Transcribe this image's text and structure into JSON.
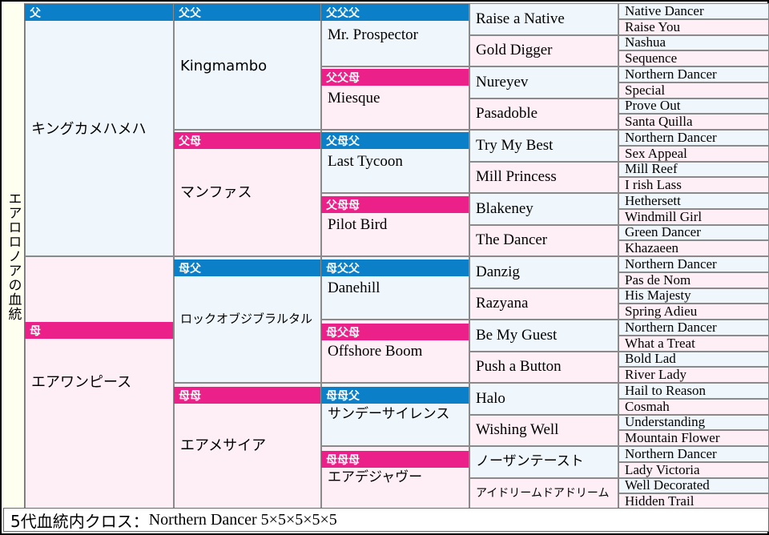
{
  "title_vertical": "エアロロノアの血統",
  "labels": {
    "sire": "父",
    "dam": "母",
    "sire_sire": "父父",
    "sire_dam": "父母",
    "dam_sire": "母父",
    "dam_dam": "母母",
    "sire_sire_sire": "父父父",
    "sire_sire_dam": "父父母",
    "sire_dam_sire": "父母父",
    "sire_dam_dam": "父母母",
    "dam_sire_sire": "母父父",
    "dam_sire_dam": "母父母",
    "dam_dam_sire": "母母父",
    "dam_dam_dam": "母母母"
  },
  "colors": {
    "sire_band": "#0b80c8",
    "dam_band": "#ec2089",
    "sire_cell": "#eff7fc",
    "dam_cell": "#fdeff5",
    "border": "#8a8a8a",
    "title_bg": "#fffff0"
  },
  "gen1": [
    {
      "name": "キングカメハメハ",
      "type": "sire"
    },
    {
      "name": "エアワンピース",
      "type": "dam"
    }
  ],
  "gen2": [
    {
      "name": "Kingmambo",
      "type": "sire"
    },
    {
      "name": "マンファス",
      "type": "dam"
    },
    {
      "name": "ロックオブジブラルタル",
      "type": "sire"
    },
    {
      "name": "エアメサイア",
      "type": "dam"
    }
  ],
  "gen3": [
    {
      "name": "Mr.  Prospector",
      "type": "sire"
    },
    {
      "name": "Miesque",
      "type": "dam"
    },
    {
      "name": "Last Tycoon",
      "type": "sire"
    },
    {
      "name": "Pilot Bird",
      "type": "dam"
    },
    {
      "name": "Danehill",
      "type": "sire"
    },
    {
      "name": "Offshore Boom",
      "type": "dam"
    },
    {
      "name": "サンデーサイレンス",
      "type": "sire"
    },
    {
      "name": "エアデジャヴー",
      "type": "dam"
    }
  ],
  "gen4": [
    {
      "name": "Raise a Native",
      "type": "sire"
    },
    {
      "name": "Gold Digger",
      "type": "dam"
    },
    {
      "name": "Nureyev",
      "type": "sire"
    },
    {
      "name": "Pasadoble",
      "type": "dam"
    },
    {
      "name": "Try My Best",
      "type": "sire"
    },
    {
      "name": "Mill Princess",
      "type": "dam"
    },
    {
      "name": "Blakeney",
      "type": "sire"
    },
    {
      "name": "The Dancer",
      "type": "dam"
    },
    {
      "name": "Danzig",
      "type": "sire"
    },
    {
      "name": "Razyana",
      "type": "dam"
    },
    {
      "name": "Be My Guest",
      "type": "sire"
    },
    {
      "name": "Push a Button",
      "type": "dam"
    },
    {
      "name": "Halo",
      "type": "sire"
    },
    {
      "name": "Wishing Well",
      "type": "dam"
    },
    {
      "name": "ノーザンテースト",
      "type": "sire"
    },
    {
      "name": "アイドリームドアドリーム",
      "type": "dam"
    }
  ],
  "gen5": [
    {
      "name": "Native Dancer",
      "type": "sire"
    },
    {
      "name": "Raise You",
      "type": "dam"
    },
    {
      "name": "Nashua",
      "type": "sire"
    },
    {
      "name": "Sequence",
      "type": "dam"
    },
    {
      "name": "Northern Dancer",
      "type": "sire"
    },
    {
      "name": "Special",
      "type": "dam"
    },
    {
      "name": "Prove Out",
      "type": "sire"
    },
    {
      "name": "Santa Quilla",
      "type": "dam"
    },
    {
      "name": "Northern Dancer",
      "type": "sire"
    },
    {
      "name": "Sex Appeal",
      "type": "dam"
    },
    {
      "name": "Mill Reef",
      "type": "sire"
    },
    {
      "name": "I rish Lass",
      "type": "dam"
    },
    {
      "name": "Hethersett",
      "type": "sire"
    },
    {
      "name": "Windmill Girl",
      "type": "dam"
    },
    {
      "name": "Green Dancer",
      "type": "sire"
    },
    {
      "name": "Khazaeen",
      "type": "dam"
    },
    {
      "name": "Northern Dancer",
      "type": "sire"
    },
    {
      "name": "Pas de Nom",
      "type": "dam"
    },
    {
      "name": "His Majesty",
      "type": "sire"
    },
    {
      "name": "Spring Adieu",
      "type": "dam"
    },
    {
      "name": "Northern Dancer",
      "type": "sire"
    },
    {
      "name": "What a Treat",
      "type": "dam"
    },
    {
      "name": "Bold Lad",
      "type": "sire"
    },
    {
      "name": "River Lady",
      "type": "dam"
    },
    {
      "name": "Hail to Reason",
      "type": "sire"
    },
    {
      "name": "Cosmah",
      "type": "dam"
    },
    {
      "name": "Understanding",
      "type": "sire"
    },
    {
      "name": "Mountain Flower",
      "type": "dam"
    },
    {
      "name": "Northern Dancer",
      "type": "sire"
    },
    {
      "name": "Lady Victoria",
      "type": "dam"
    },
    {
      "name": "Well Decorated",
      "type": "sire"
    },
    {
      "name": "Hidden Trail",
      "type": "dam"
    }
  ],
  "footer": {
    "prefix": "5代血統内クロス：",
    "cross": "Northern Dancer 5×5×5×5×5"
  }
}
